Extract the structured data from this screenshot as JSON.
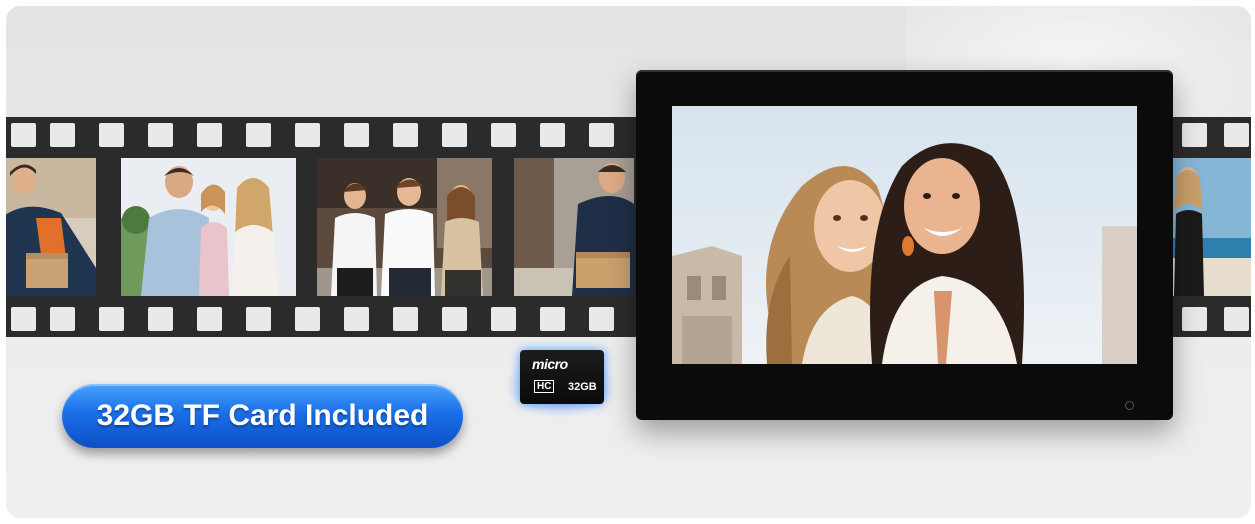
{
  "badge": {
    "label": "32GB TF Card Included"
  },
  "sd_card": {
    "brand": "micro",
    "type": "HC",
    "capacity": "32GB"
  },
  "colors": {
    "badge_blue": "#1a6fe8",
    "film_dark": "#2b2b2b",
    "device_black": "#0b0b0b"
  },
  "film_photos": [
    "delivery-person",
    "family-with-child",
    "three-friends",
    "delivery-person-street",
    "woman-at-beach"
  ],
  "screen_photo": "two-women-smiling"
}
